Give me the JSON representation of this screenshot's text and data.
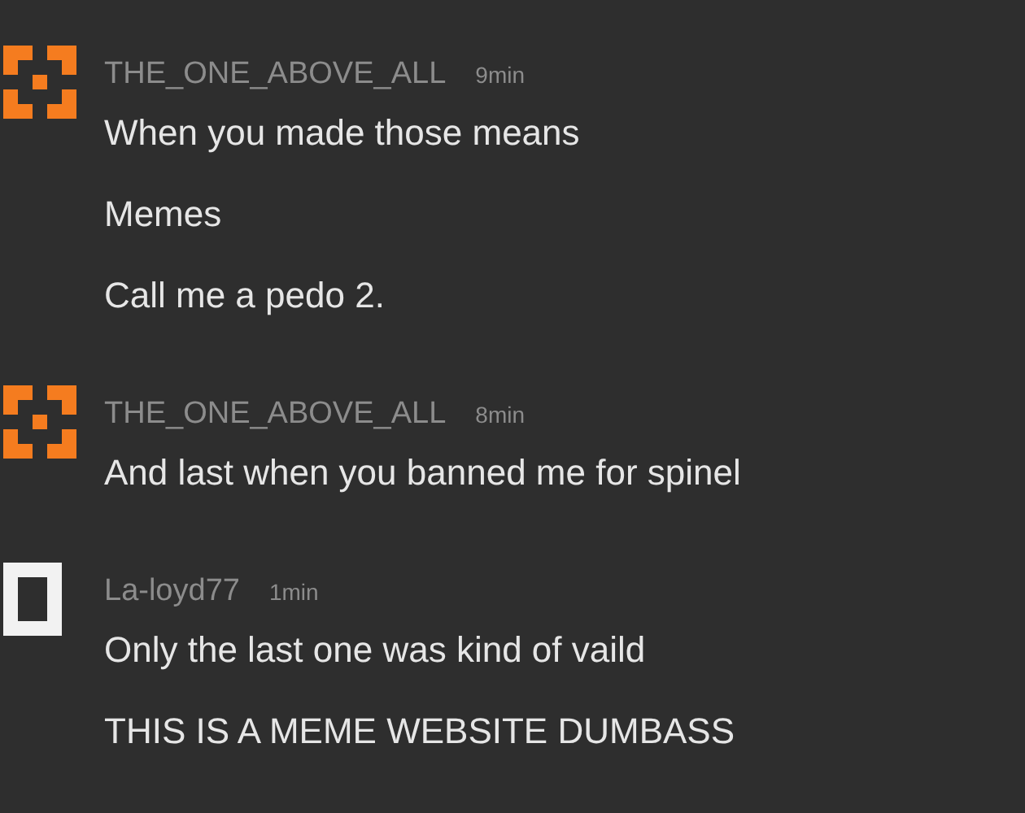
{
  "comments": [
    {
      "avatar": {
        "kind": "corners",
        "color": "#f57c1f"
      },
      "author": "THE_ONE_ABOVE_ALL",
      "time": "9min",
      "lines": [
        "When you made those means",
        "Memes",
        "Call me a pedo 2."
      ]
    },
    {
      "avatar": {
        "kind": "corners",
        "color": "#f57c1f"
      },
      "author": "THE_ONE_ABOVE_ALL",
      "time": "8min",
      "lines": [
        "And last when you banned me for spinel"
      ]
    },
    {
      "avatar": {
        "kind": "block",
        "color": "#f2f2f2"
      },
      "author": "La-loyd77",
      "time": "1min",
      "lines": [
        "Only the last one was kind of vaild",
        "THIS IS A MEME WEBSITE DUMBASS"
      ]
    }
  ]
}
